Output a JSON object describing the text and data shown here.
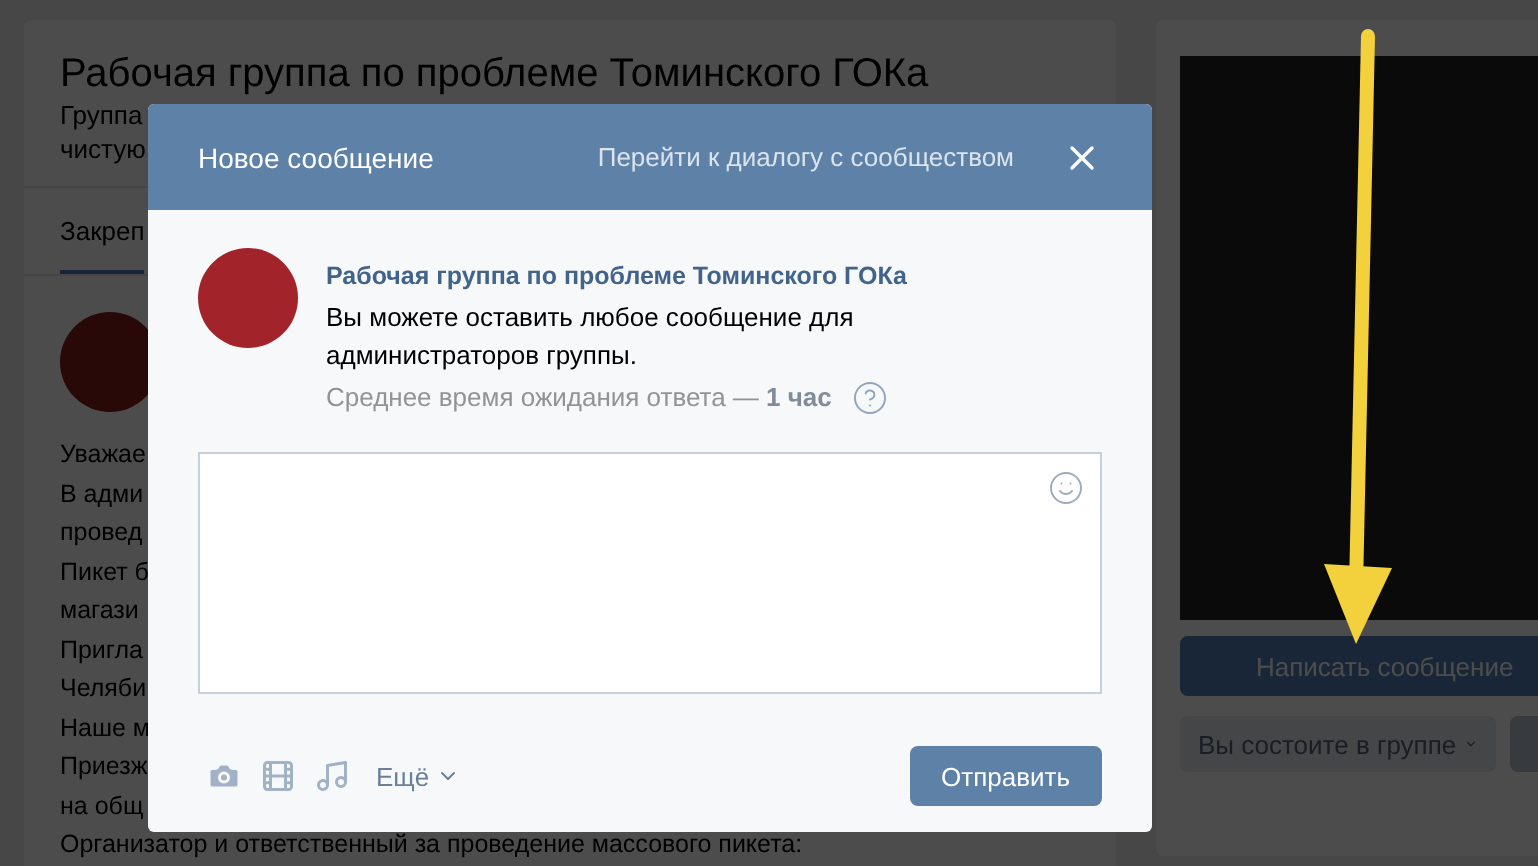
{
  "page": {
    "group_title": "Рабочая группа по проблеме Томинского ГОКа",
    "description_lines": [
      "Группа",
      "чистую"
    ],
    "tab": {
      "label": "Закреп",
      "selected": true
    },
    "post_lines": [
      "Уважае",
      "В адми",
      "провед",
      "Пикет б",
      "магази",
      "Пригла",
      "Челяби",
      "Наше м",
      "Приезж",
      "на общ",
      "Организатор и ответственный за проведение массового пикета:"
    ]
  },
  "sidebar": {
    "message_button": "Написать сообщение",
    "membership_button": "Вы состоите в группе"
  },
  "modal": {
    "title": "Новое сообщение",
    "dialog_link": "Перейти к диалогу с сообществом",
    "group_name": "Рабочая группа по проблеме Томинского ГОКа",
    "description": "Вы можете оставить любое сообщение для администраторов группы.",
    "wait_text": "Среднее время ожидания ответа — **1 час**",
    "more": "Ещё",
    "send": "Отправить"
  }
}
